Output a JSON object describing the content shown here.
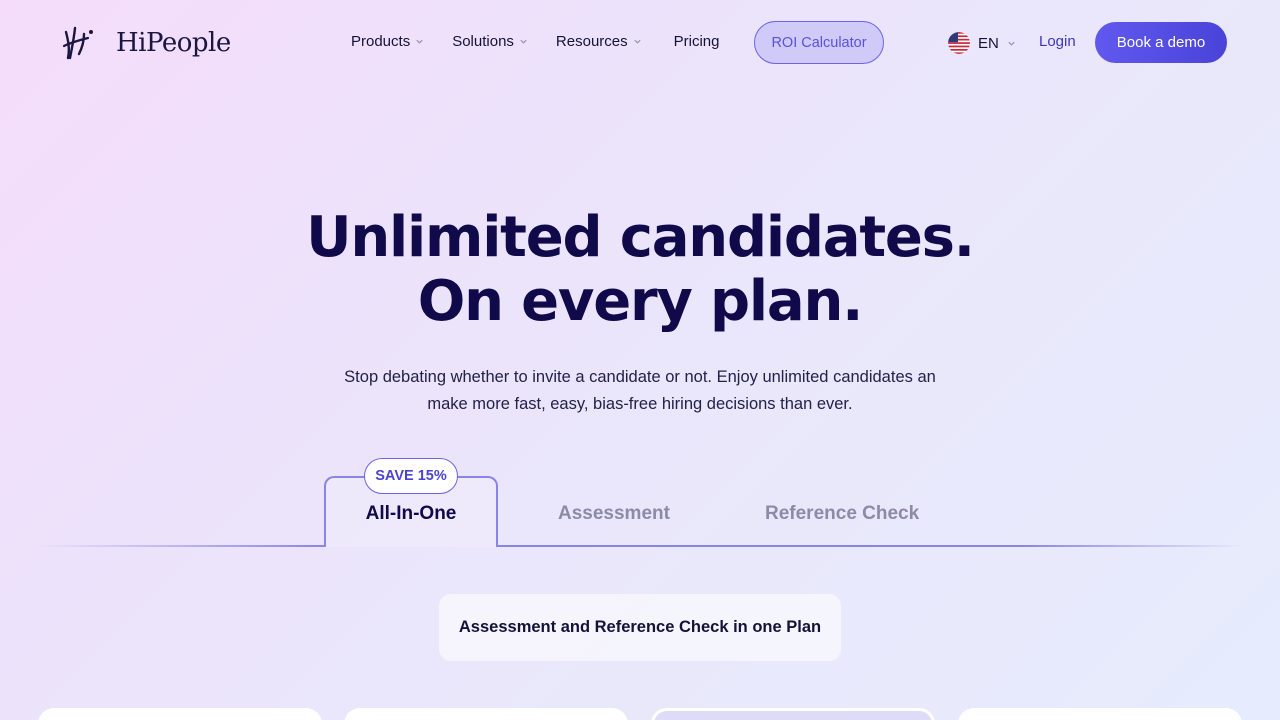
{
  "brand": {
    "name": "HiPeople"
  },
  "nav": {
    "items": [
      {
        "label": "Products",
        "has_dropdown": true
      },
      {
        "label": "Solutions",
        "has_dropdown": true
      },
      {
        "label": "Resources",
        "has_dropdown": true
      },
      {
        "label": "Pricing",
        "has_dropdown": false
      }
    ],
    "roi_label": "ROI Calculator",
    "language": "EN",
    "login_label": "Login",
    "demo_label": "Book a demo"
  },
  "hero": {
    "title_line1": "Unlimited candidates.",
    "title_line2": "On every plan.",
    "subtitle_line1": "Stop debating whether to invite a candidate or not. Enjoy unlimited candidates an",
    "subtitle_line2": "make more fast, easy, bias-free hiring decisions than ever."
  },
  "tabs": {
    "items": [
      {
        "label": "All-In-One",
        "active": true
      },
      {
        "label": "Assessment",
        "active": false
      },
      {
        "label": "Reference Check",
        "active": false
      }
    ],
    "badge": "SAVE 15%"
  },
  "plan_note": "Assessment and Reference Check in one Plan",
  "colors": {
    "accent": "#5a52e0",
    "title": "#10094a",
    "muted_tab": "#8c8aa8"
  }
}
